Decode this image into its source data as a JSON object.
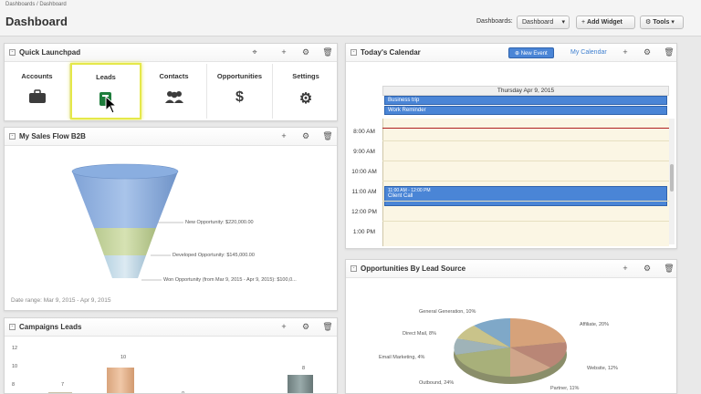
{
  "header": {
    "breadcrumb": "Dashboards / Dashboard",
    "title": "Dashboard",
    "dashboards_label": "Dashboards:",
    "dashboard_select": "Dashboard",
    "add_widget": "Add Widget",
    "tools": "Tools"
  },
  "quick_launchpad": {
    "title": "Quick Launchpad",
    "items": [
      {
        "label": "Accounts",
        "icon": "briefcase-icon"
      },
      {
        "label": "Leads",
        "icon": "lead-card-icon"
      },
      {
        "label": "Contacts",
        "icon": "people-icon"
      },
      {
        "label": "Opportunities",
        "icon": "dollar-icon"
      },
      {
        "label": "Settings",
        "icon": "gears-icon"
      }
    ]
  },
  "sales_flow": {
    "title": "My Sales Flow B2B",
    "labels": [
      "New Opportunity: $220,000.00",
      "Developed Opportunity: $145,000.00",
      "Won Opportunity (from Mar 9, 2015 - Apr 9, 2015): $100,0..."
    ],
    "date_range": "Date range: Mar 9, 2015 - Apr 9, 2015"
  },
  "campaigns": {
    "title": "Campaigns Leads",
    "y_ticks": [
      "12",
      "10",
      "8"
    ],
    "bar_labels": [
      "7",
      "10",
      "0",
      "8"
    ]
  },
  "calendar": {
    "title": "Today's Calendar",
    "new_event": "New Event",
    "my_calendar": "My Calendar",
    "day_header": "Thursday Apr 9, 2015",
    "all_day_events": [
      "Business trip",
      "Work Reminder"
    ],
    "hours": [
      "8:00 AM",
      "9:00 AM",
      "10:00 AM",
      "11:00 AM",
      "12:00 PM",
      "1:00 PM"
    ],
    "event_time": "11:00 AM - 12:00 PM",
    "event_title": "Client Call"
  },
  "lead_source": {
    "title": "Opportunities By Lead Source",
    "labels": [
      "General Generation, 10%",
      "Affiliate, 20%",
      "Direct Mail, 8%",
      "Email Marketing, 4%",
      "Website, 12%",
      "Outbound, 24%",
      "Partner, 11%"
    ]
  },
  "colors": {
    "accent_blue": "#3f7fcf",
    "event_blue": "#4a85d6",
    "highlight_yellow": "#e5e84a",
    "now_line": "#b02020"
  }
}
